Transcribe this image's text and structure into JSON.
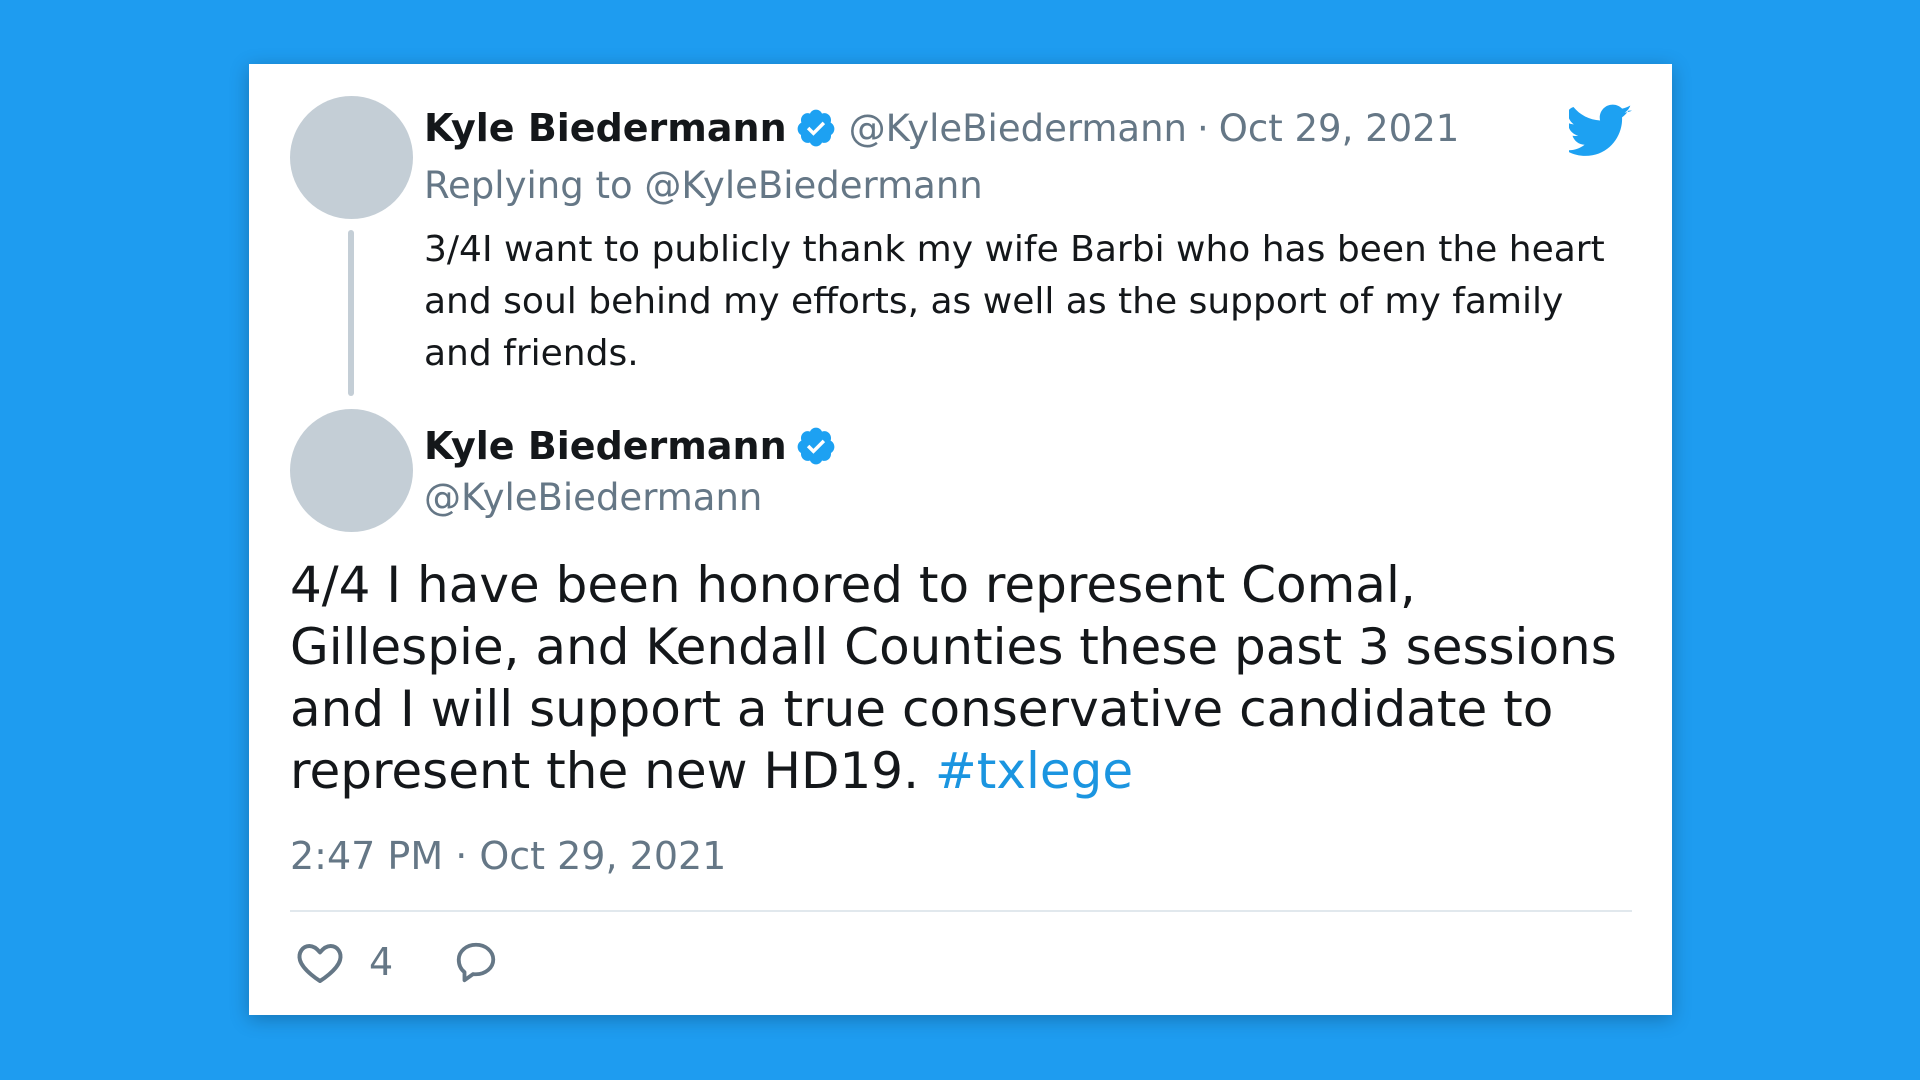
{
  "colors": {
    "background": "#1e9cf0",
    "accent": "#1da1f2",
    "hashtag": "#1b95e0",
    "muted_text": "#657786",
    "avatar_placeholder": "#c4ced6"
  },
  "reply_tweet": {
    "author_name": "Kyle Biedermann",
    "verified_icon": "verified-badge-icon",
    "handle": "@KyleBiedermann",
    "separator": "·",
    "date": "Oct 29, 2021",
    "replying_to": "Replying to @KyleBiedermann",
    "text": "3/4I want to publicly thank my wife Barbi who has been the heart and soul behind my efforts, as well as the support of my family and friends."
  },
  "brand_icon": "twitter-bird-icon",
  "main_tweet": {
    "author_name": "Kyle Biedermann",
    "verified_icon": "verified-badge-icon",
    "handle": "@KyleBiedermann",
    "text_before_hashtag": "4/4 I have been honored to represent Comal, Gillespie, and Kendall Counties these past 3 sessions and I will support a true conservative candidate to represent the new HD19.",
    "hashtag": "#txlege",
    "timestamp": "2:47 PM · Oct 29, 2021",
    "like_icon": "heart-icon",
    "like_count": "4",
    "reply_icon": "reply-bubble-icon"
  }
}
